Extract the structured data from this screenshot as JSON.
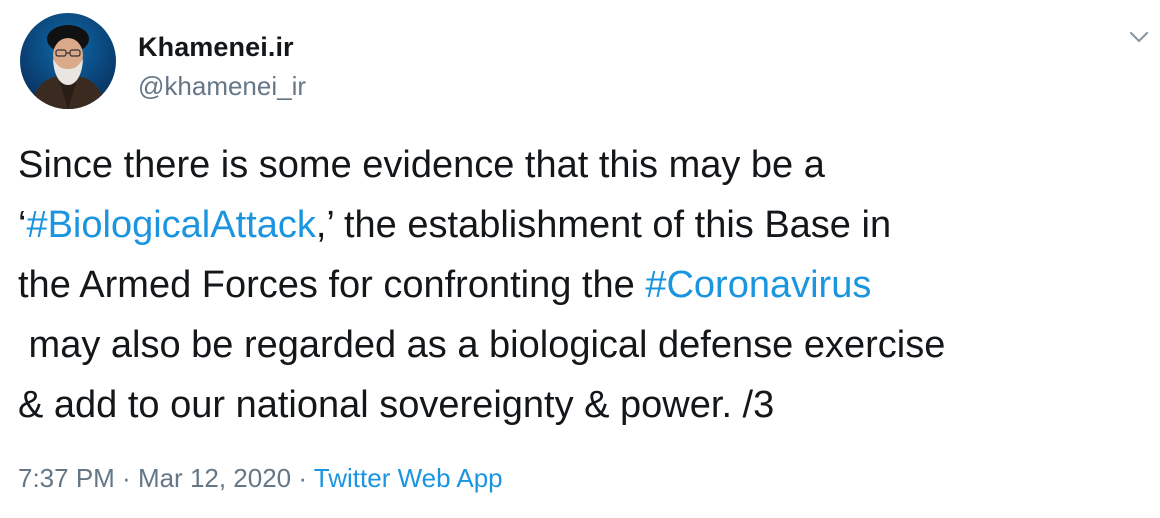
{
  "author": {
    "display_name": "Khamenei.ir",
    "handle": "@khamenei_ir",
    "avatar_icon": "profile-photo"
  },
  "menu_icon": "chevron-down-icon",
  "tweet": {
    "line1": "Since there is some evidence that this may be a",
    "line2_open": "‘",
    "hashtag1": "#BiologicalAttack",
    "line2_rest": ",’ the establishment of this Base in",
    "line3_text": "the Armed Forces for confronting the ",
    "hashtag2": "#Coronavirus",
    "line4": " may also be regarded as a biological defense exercise",
    "line5": "& add to our national sovereignty & power. /3"
  },
  "meta": {
    "time": "7:37 PM",
    "separator": " · ",
    "date": "Mar 12, 2020",
    "source": "Twitter Web App"
  },
  "colors": {
    "link": "#1b95e0",
    "secondary": "#657786",
    "text": "#14171a"
  }
}
